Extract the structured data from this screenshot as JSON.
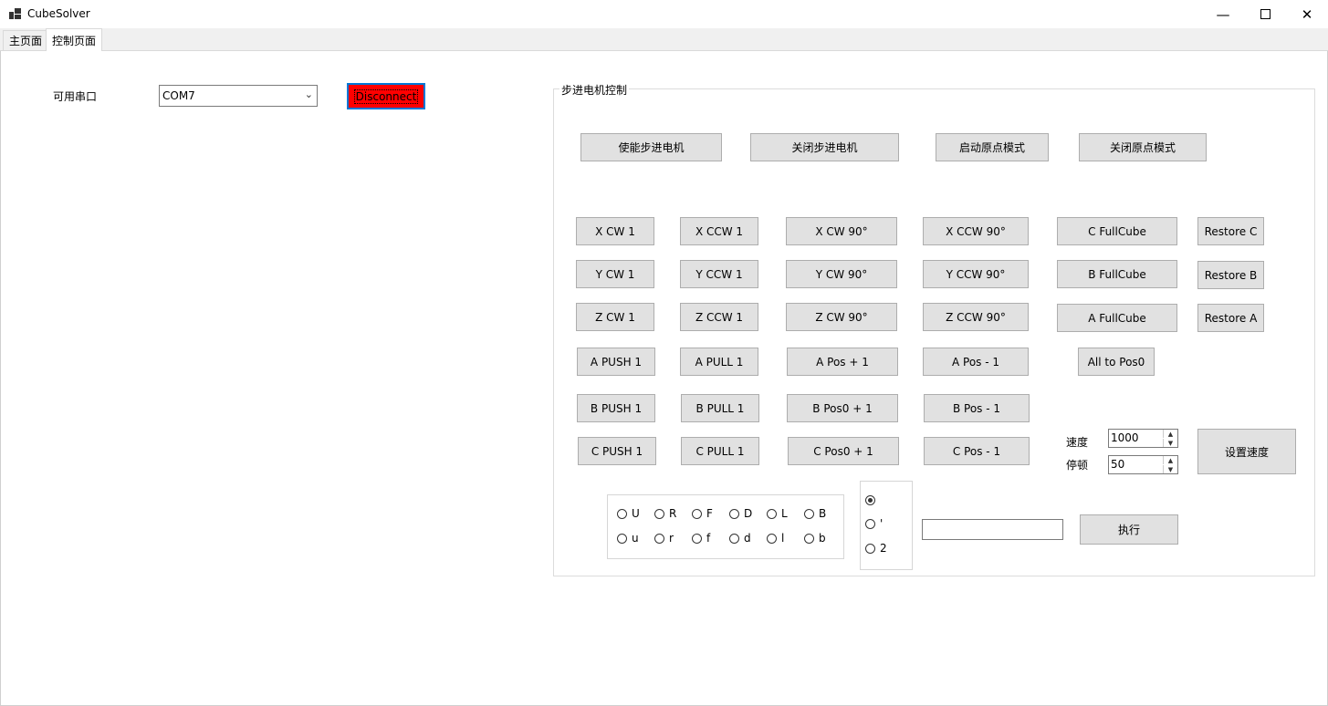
{
  "window": {
    "title": "CubeSolver",
    "min_icon": "minimize-icon",
    "max_icon": "maximize-icon",
    "close_icon": "close-icon"
  },
  "tabs": [
    {
      "label": "主页面"
    },
    {
      "label": "控制页面"
    }
  ],
  "serial": {
    "label": "可用串口",
    "port": "COM7",
    "disconnect": "Disconnect"
  },
  "stepper": {
    "title": "步进电机控制",
    "top_buttons": [
      "使能步进电机",
      "关闭步进电机",
      "启动原点模式",
      "关闭原点模式"
    ],
    "rows": [
      [
        "X CW 1",
        "X CCW 1",
        "X CW 90°",
        "X CCW 90°",
        "C FullCube",
        "Restore C"
      ],
      [
        "Y CW 1",
        "Y CCW 1",
        "Y CW 90°",
        "Y CCW 90°",
        "B FullCube",
        "Restore B"
      ],
      [
        "Z CW 1",
        "Z CCW 1",
        "Z CW 90°",
        "Z CCW 90°",
        "A FullCube",
        "Restore A"
      ],
      [
        "A PUSH 1",
        "A PULL 1",
        "A Pos + 1",
        "A Pos - 1",
        "All to Pos0"
      ],
      [
        "B PUSH 1",
        "B PULL 1",
        "B Pos0 + 1",
        "B Pos - 1"
      ],
      [
        "C PUSH 1",
        "C PULL 1",
        "C Pos0 + 1",
        "C Pos - 1"
      ]
    ],
    "speed": {
      "speed_label": "速度",
      "speed_value": "1000",
      "pause_label": "停顿",
      "pause_value": "50",
      "set_button": "设置速度"
    },
    "faces_upper": [
      "U",
      "R",
      "F",
      "D",
      "L",
      "B"
    ],
    "faces_lower": [
      "u",
      "r",
      "f",
      "d",
      "l",
      "b"
    ],
    "modifiers": [
      "",
      "'",
      "2"
    ],
    "modifier_selected": 0,
    "command_input": "",
    "execute_button": "执行"
  }
}
